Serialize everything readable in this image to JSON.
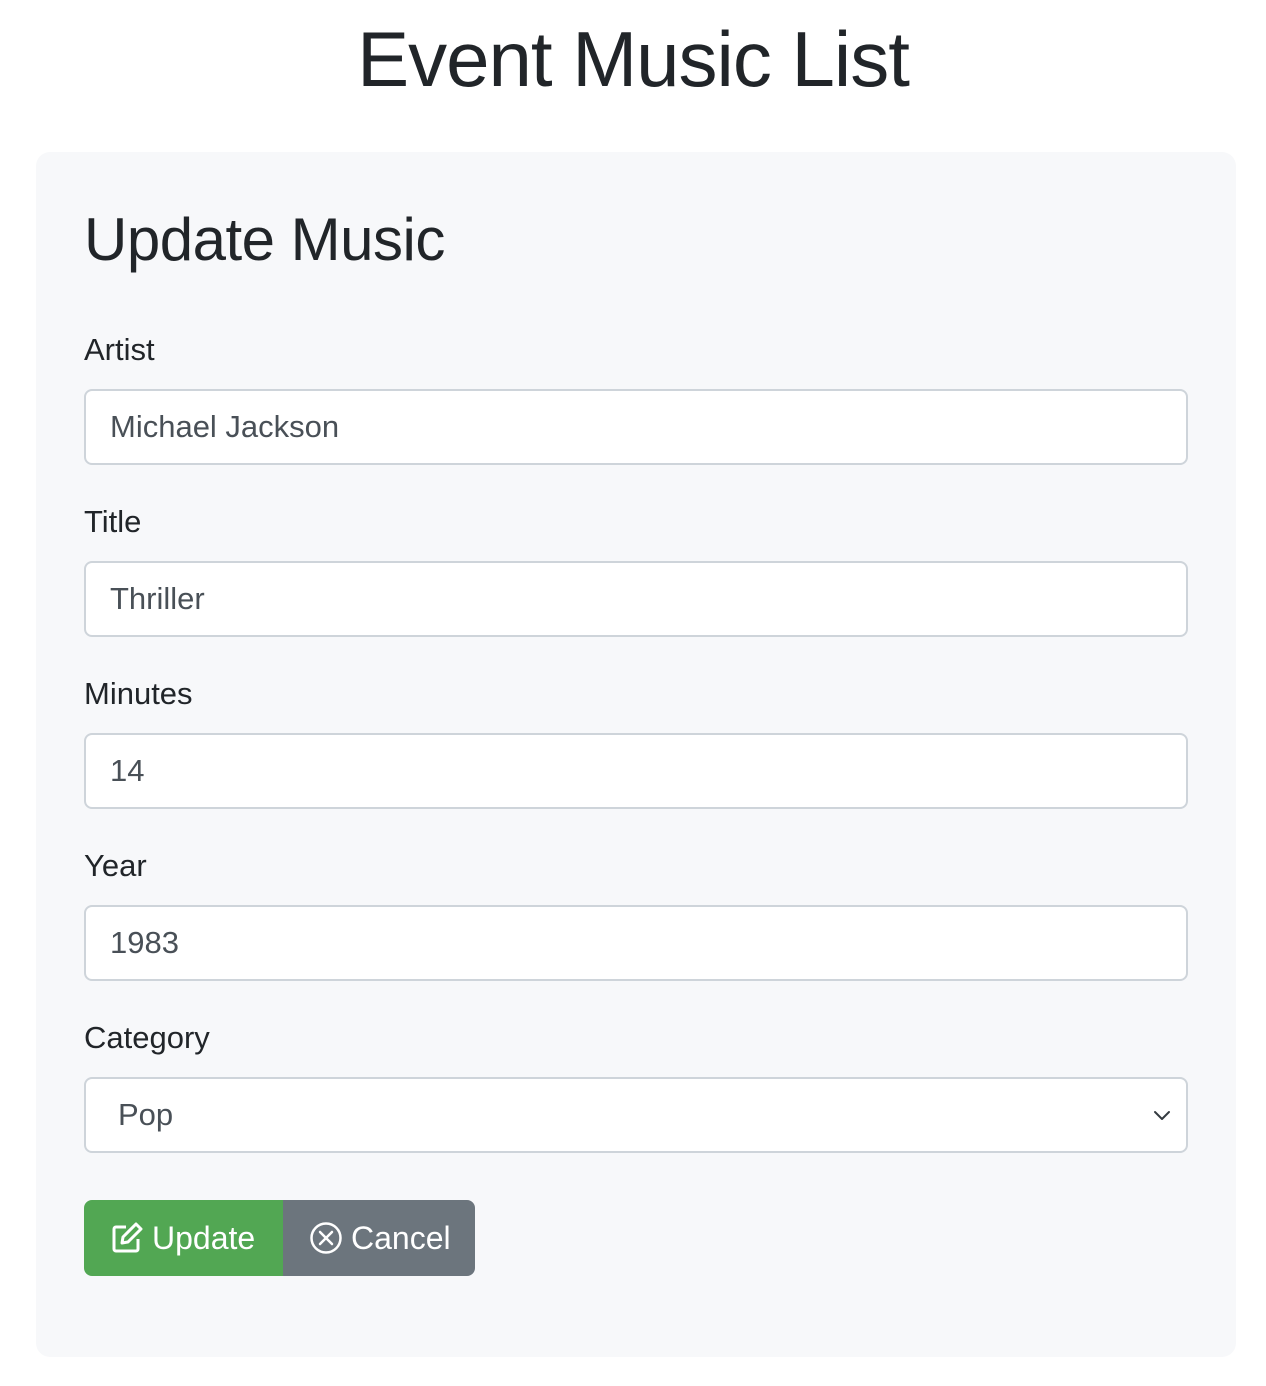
{
  "header": {
    "title": "Event Music List"
  },
  "form": {
    "heading": "Update Music",
    "fields": {
      "artist": {
        "label": "Artist",
        "value": "Michael Jackson"
      },
      "title": {
        "label": "Title",
        "value": "Thriller"
      },
      "minutes": {
        "label": "Minutes",
        "value": "14"
      },
      "year": {
        "label": "Year",
        "value": "1983"
      },
      "category": {
        "label": "Category",
        "value": "Pop",
        "icon": "chevron-down-icon"
      }
    },
    "buttons": {
      "update": {
        "label": "Update",
        "icon": "edit-icon",
        "color": "#52a753"
      },
      "cancel": {
        "label": "Cancel",
        "icon": "circle-x-icon",
        "color": "#6c757d"
      }
    }
  },
  "colors": {
    "card_background": "#f7f8fa",
    "input_border": "#ced4da",
    "text": "#212529"
  }
}
